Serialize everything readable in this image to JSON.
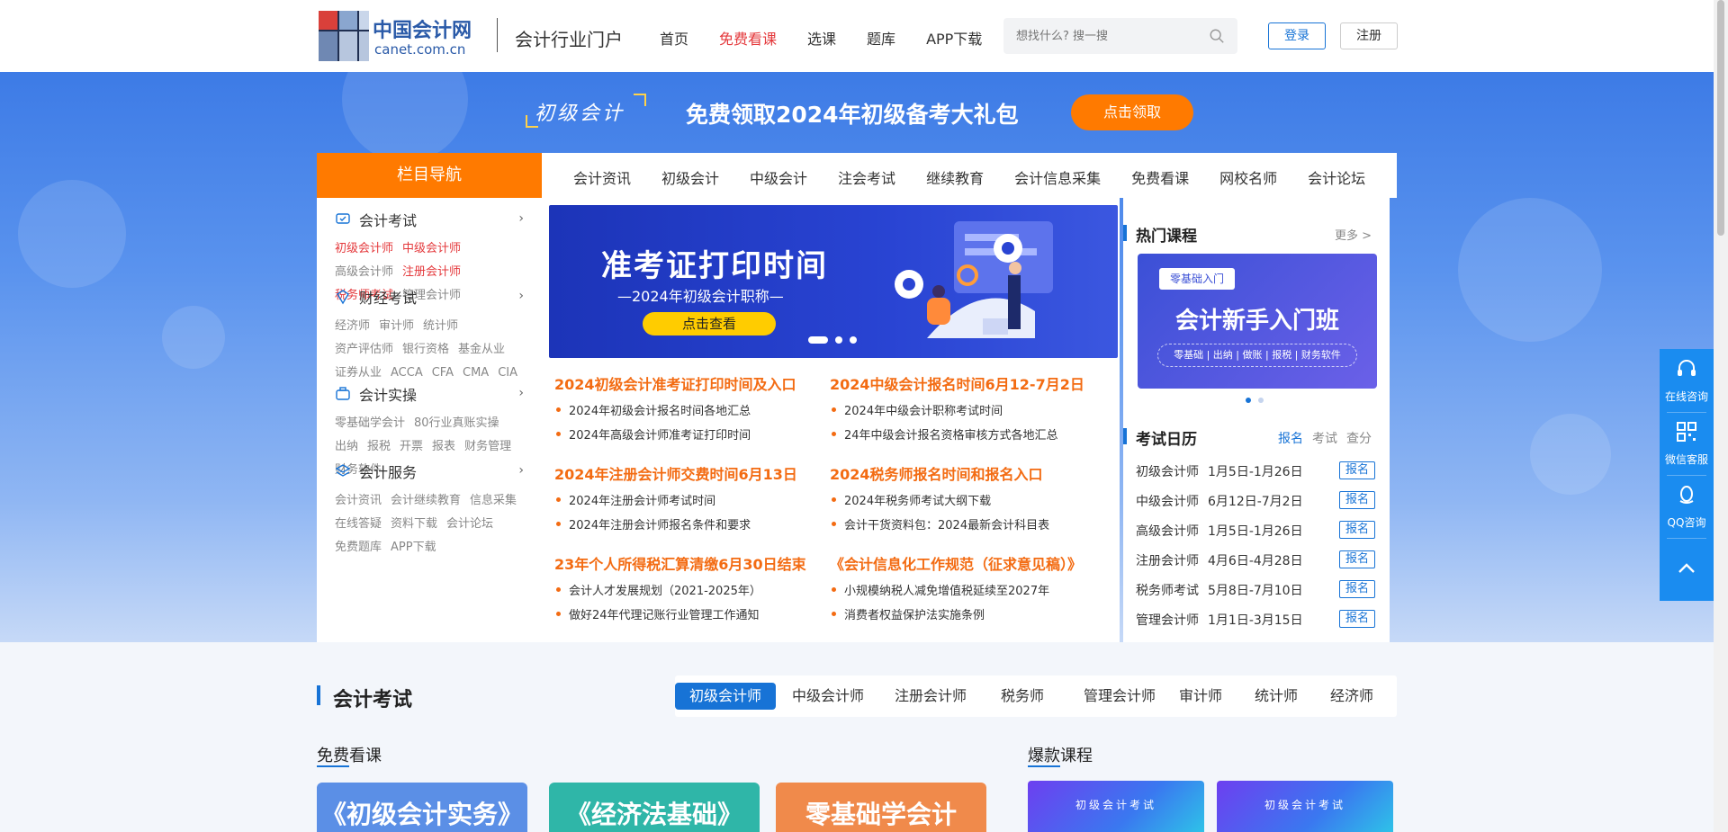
{
  "header": {
    "logo_name": "中国会计网",
    "logo_domain": "canet.com.cn",
    "portal": "会计行业门户",
    "nav": [
      {
        "label": "首页",
        "hot": false
      },
      {
        "label": "免费看课",
        "hot": true
      },
      {
        "label": "选课",
        "hot": false
      },
      {
        "label": "题库",
        "hot": false
      },
      {
        "label": "APP下载",
        "hot": false
      }
    ],
    "search_placeholder": "想找什么? 搜一搜",
    "login": "登录",
    "register": "注册"
  },
  "promo": {
    "brand": "初级会计",
    "title": "免费领取2024年初级备考大礼包",
    "button": "点击领取"
  },
  "column_nav": {
    "label": "栏目导航",
    "items": [
      "会计资讯",
      "初级会计",
      "中级会计",
      "注会考试",
      "继续教育",
      "会计信息采集",
      "免费看课",
      "网校名师",
      "会计论坛"
    ]
  },
  "sidebar": [
    {
      "title": "会计考试",
      "icon": "exam-icon",
      "links": [
        {
          "t": "初级会计师",
          "red": true
        },
        {
          "t": "中级会计师",
          "red": true
        },
        {
          "t": "高级会计师",
          "red": false
        },
        {
          "t": "注册会计师",
          "red": true
        },
        {
          "t": "税务师考试",
          "red": true
        },
        {
          "t": "管理会计师",
          "red": false
        }
      ]
    },
    {
      "title": "财经考试",
      "icon": "finance-icon",
      "links": [
        {
          "t": "经济师",
          "red": false
        },
        {
          "t": "审计师",
          "red": false
        },
        {
          "t": "统计师",
          "red": false
        },
        {
          "t": "资产评估师",
          "red": false
        },
        {
          "t": "银行资格",
          "red": false
        },
        {
          "t": "基金从业",
          "red": false
        },
        {
          "t": "证券从业",
          "red": false
        },
        {
          "t": "ACCA",
          "red": false
        },
        {
          "t": "CFA",
          "red": false
        },
        {
          "t": "CMA",
          "red": false
        },
        {
          "t": "CIA",
          "red": false
        }
      ]
    },
    {
      "title": "会计实操",
      "icon": "briefcase-icon",
      "links": [
        {
          "t": "零基础学会计",
          "red": false
        },
        {
          "t": "80行业真账实操",
          "red": false
        },
        {
          "t": "出纳",
          "red": false
        },
        {
          "t": "报税",
          "red": false
        },
        {
          "t": "开票",
          "red": false
        },
        {
          "t": "报表",
          "red": false
        },
        {
          "t": "财务管理",
          "red": false
        },
        {
          "t": "财务软件",
          "red": false
        }
      ]
    },
    {
      "title": "会计服务",
      "icon": "layers-icon",
      "links": [
        {
          "t": "会计资讯",
          "red": false
        },
        {
          "t": "会计继续教育",
          "red": false
        },
        {
          "t": "信息采集",
          "red": false
        },
        {
          "t": "在线答疑",
          "red": false
        },
        {
          "t": "资料下载",
          "red": false
        },
        {
          "t": "会计论坛",
          "red": false
        },
        {
          "t": "免费题库",
          "red": false
        },
        {
          "t": "APP下载",
          "red": false
        }
      ]
    }
  ],
  "banner": {
    "title": "准考证打印时间",
    "subtitle": "—2024年初级会计职称—",
    "button": "点击查看"
  },
  "news": [
    {
      "title": "2024初级会计准考证打印时间及入口",
      "items": [
        "2024年初级会计报名时间各地汇总",
        "2024年高级会计师准考证打印时间"
      ]
    },
    {
      "title": "2024中级会计报名时间6月12-7月2日",
      "items": [
        "2024年中级会计职称考试时间",
        "24年中级会计报名资格审核方式各地汇总"
      ]
    },
    {
      "title": "2024年注册会计师交费时间6月13日",
      "items": [
        "2024年注册会计师考试时间",
        "2024年注册会计师报名条件和要求"
      ]
    },
    {
      "title": "2024税务师报名时间和报名入口",
      "items": [
        "2024年税务师考试大纲下载",
        "会计干货资料包：2024最新会计科目表"
      ]
    },
    {
      "title": "23年个人所得税汇算清缴6月30日结束",
      "items": [
        "会计人才发展规划（2021-2025年）",
        "做好24年代理记账行业管理工作通知"
      ]
    },
    {
      "title": "《会计信息化工作规范（征求意见稿）》",
      "items": [
        "小规模纳税人减免增值税延续至2027年",
        "消费者权益保护法实施条例"
      ]
    }
  ],
  "hot_courses": {
    "title": "热门课程",
    "more": "更多 >",
    "card_tag": "零基础入门",
    "card_title": "会计新手入门班",
    "card_sub": "零基础 | 出纳 | 做账 | 报税 | 财务软件"
  },
  "calendar": {
    "title": "考试日历",
    "tabs": [
      {
        "label": "报名",
        "on": true
      },
      {
        "label": "考试",
        "on": false
      },
      {
        "label": "查分",
        "on": false
      }
    ],
    "rows": [
      {
        "name": "初级会计师",
        "date": "1月5日-1月26日",
        "btn": "报名"
      },
      {
        "name": "中级会计师",
        "date": "6月12日-7月2日",
        "btn": "报名"
      },
      {
        "name": "高级会计师",
        "date": "1月5日-1月26日",
        "btn": "报名"
      },
      {
        "name": "注册会计师",
        "date": "4月6日-4月28日",
        "btn": "报名"
      },
      {
        "name": "税务师考试",
        "date": "5月8日-7月10日",
        "btn": "报名"
      },
      {
        "name": "管理会计师",
        "date": "1月1日-3月15日",
        "btn": "报名"
      }
    ]
  },
  "float_panel": {
    "online": "在线咨询",
    "wechat": "微信客服",
    "qq": "QQ咨询"
  },
  "section2": {
    "title": "会计考试",
    "tabs": [
      {
        "label": "初级会计师",
        "on": true
      },
      {
        "label": "中级会计师",
        "on": false
      },
      {
        "label": "注册会计师",
        "on": false
      },
      {
        "label": "税务师",
        "on": false
      },
      {
        "label": "管理会计师",
        "on": false
      },
      {
        "label": "审计师",
        "on": false
      },
      {
        "label": "统计师",
        "on": false
      },
      {
        "label": "经济师",
        "on": false
      }
    ],
    "free_label_a": "免费",
    "free_label_b": "看课",
    "hot_label_a": "爆款",
    "hot_label_b": "课程",
    "free_cards": [
      {
        "title": "《初级会计实务》",
        "color": "#5b8fe6"
      },
      {
        "title": "《经济法基础》",
        "color": "#2fb6a8"
      },
      {
        "title": "零基础学会计",
        "color": "#f08a4b"
      }
    ],
    "hot_cards": [
      "初级会计考试",
      "初级会计考试"
    ]
  },
  "colors": {
    "accent": "#1773d6",
    "orange": "#ff7a00",
    "news_orange": "#f36b12",
    "red": "#e4393c"
  }
}
